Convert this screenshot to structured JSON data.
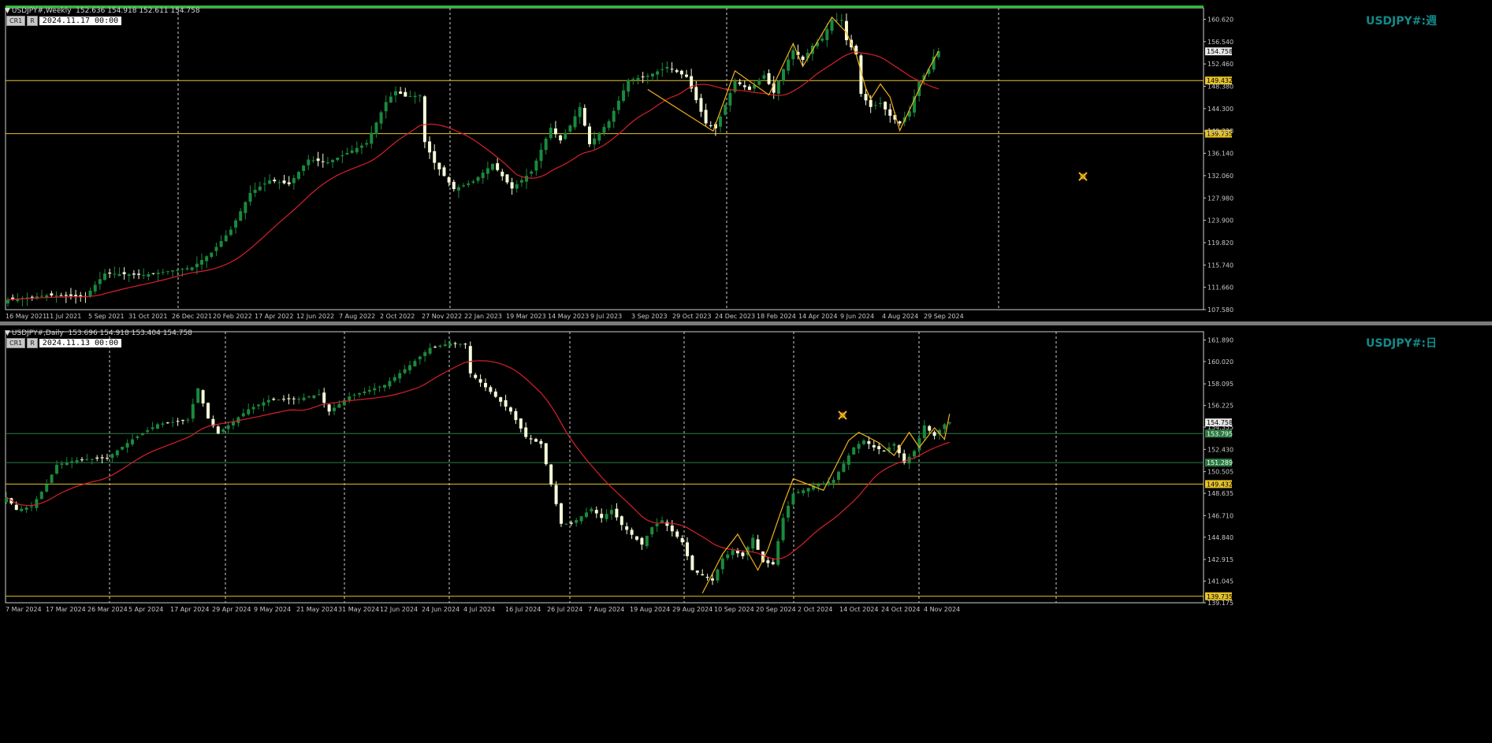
{
  "colors": {
    "bull": "#1a8a3c",
    "bear": "#f4fbd8",
    "ma": "#d8202a",
    "zigzag": "#f2b21c",
    "level": "#e6c22a",
    "level_green": "#2e7a46",
    "axis": "#c8c8c8",
    "frame": "#cfcfcf"
  },
  "chart_data": [
    {
      "type": "candlestick",
      "title": "USDJPY#,Weekly",
      "ohlc_text": "152.636 154.918 152.611 154.758",
      "toolbar": {
        "b1": "CR1",
        "b2": "R",
        "date": "2024.11.17 00:00"
      },
      "symbol_label": "USDJPY#:週",
      "ylim": [
        107.58,
        162.7
      ],
      "yticks": [
        "160.620",
        "156.540",
        "152.460",
        "148.380",
        "144.300",
        "140.220",
        "136.140",
        "132.060",
        "127.980",
        "123.900",
        "119.820",
        "115.740",
        "111.660",
        "107.580"
      ],
      "xticks": [
        "16 May 2021",
        "11 Jul 2021",
        "5 Sep 2021",
        "31 Oct 2021",
        "26 Dec 2021",
        "20 Feb 2022",
        "17 Apr 2022",
        "12 Jun 2022",
        "7 Aug 2022",
        "2 Oct 2022",
        "27 Nov 2022",
        "22 Jan 2023",
        "19 Mar 2023",
        "14 May 2023",
        "9 Jul 2023",
        "3 Sep 2023",
        "29 Oct 2023",
        "24 Dec 2023",
        "18 Feb 2024",
        "14 Apr 2024",
        "9 Jun 2024",
        "4 Aug 2024",
        "29 Sep 2024"
      ],
      "levels": [
        {
          "value": 149.432,
          "label": "149.432",
          "color": "yellow"
        },
        {
          "value": 139.735,
          "label": "139.735",
          "color": "yellow"
        }
      ],
      "current_price": "154.758",
      "close_anchors": [
        [
          0,
          109.4
        ],
        [
          8,
          110.2
        ],
        [
          16,
          110.0
        ],
        [
          20,
          114.2
        ],
        [
          28,
          113.9
        ],
        [
          38,
          115.3
        ],
        [
          42,
          118.0
        ],
        [
          46,
          122.2
        ],
        [
          50,
          128.9
        ],
        [
          54,
          131.2
        ],
        [
          58,
          130.5
        ],
        [
          62,
          135.0
        ],
        [
          66,
          134.5
        ],
        [
          70,
          136.2
        ],
        [
          74,
          138.0
        ],
        [
          78,
          145.5
        ],
        [
          80,
          147.5
        ],
        [
          82,
          146.5
        ],
        [
          85,
          146.7
        ],
        [
          86,
          138.2
        ],
        [
          88,
          134.4
        ],
        [
          92,
          129.6
        ],
        [
          96,
          131.0
        ],
        [
          100,
          134.2
        ],
        [
          104,
          129.7
        ],
        [
          108,
          132.8
        ],
        [
          112,
          140.8
        ],
        [
          114,
          138.5
        ],
        [
          116,
          141.2
        ],
        [
          118,
          144.6
        ],
        [
          120,
          137.8
        ],
        [
          124,
          142.0
        ],
        [
          128,
          149.5
        ],
        [
          132,
          150.3
        ],
        [
          136,
          151.9
        ],
        [
          140,
          150.1
        ],
        [
          144,
          141.6
        ],
        [
          146,
          140.7
        ],
        [
          148,
          145.0
        ],
        [
          150,
          149.3
        ],
        [
          153,
          147.7
        ],
        [
          156,
          150.4
        ],
        [
          158,
          147.2
        ],
        [
          160,
          151.5
        ],
        [
          162,
          155.0
        ],
        [
          164,
          153.2
        ],
        [
          166,
          155.8
        ],
        [
          168,
          157.1
        ],
        [
          170,
          160.5
        ],
        [
          172,
          160.5
        ],
        [
          173,
          156.8
        ],
        [
          175,
          154.2
        ],
        [
          176,
          147.0
        ],
        [
          178,
          144.6
        ],
        [
          180,
          145.3
        ],
        [
          182,
          143.0
        ],
        [
          184,
          141.6
        ],
        [
          186,
          143.8
        ],
        [
          188,
          149.3
        ],
        [
          190,
          151.5
        ],
        [
          191,
          153.8
        ],
        [
          192,
          154.758
        ]
      ],
      "zigzag": [
        [
          132,
          147.8
        ],
        [
          145.5,
          140.2
        ],
        [
          150,
          151.2
        ],
        [
          157,
          146.8
        ],
        [
          162,
          156.2
        ],
        [
          164,
          152.0
        ],
        [
          170,
          161.0
        ],
        [
          173,
          158.2
        ],
        [
          175,
          154.2
        ],
        [
          177,
          148.0
        ],
        [
          178,
          146.0
        ],
        [
          180,
          148.8
        ],
        [
          182,
          146.4
        ],
        [
          184,
          140.3
        ],
        [
          190,
          151.6
        ],
        [
          192,
          154.8
        ]
      ],
      "hidden_count": 192
    },
    {
      "type": "candlestick",
      "title": "USDJPY#,Daily",
      "ohlc_text": "153.696 154.918 153.404 154.758",
      "toolbar": {
        "b1": "CR1",
        "b2": "R",
        "date": "2024.11.13 00:00"
      },
      "symbol_label": "USDJPY#:日",
      "ylim": [
        139.175,
        162.6
      ],
      "yticks": [
        "161.890",
        "160.020",
        "158.095",
        "156.225",
        "154.355",
        "152.430",
        "150.505",
        "148.635",
        "146.710",
        "144.840",
        "142.915",
        "141.045",
        "139.175"
      ],
      "xticks": [
        "7 Mar 2024",
        "17 Mar 2024",
        "26 Mar 2024",
        "5 Apr 2024",
        "17 Apr 2024",
        "29 Apr 2024",
        "9 May 2024",
        "21 May 2024",
        "31 May 2024",
        "12 Jun 2024",
        "24 Jun 2024",
        "4 Jul 2024",
        "16 Jul 2024",
        "26 Jul 2024",
        "7 Aug 2024",
        "19 Aug 2024",
        "29 Aug 2024",
        "10 Sep 2024",
        "20 Sep 2024",
        "2 Oct 2024",
        "14 Oct 2024",
        "24 Oct 2024",
        "4 Nov 2024"
      ],
      "levels": [
        {
          "value": 153.795,
          "label": "153.795",
          "color": "green"
        },
        {
          "value": 151.289,
          "label": "151.289",
          "color": "green"
        },
        {
          "value": 149.432,
          "label": "149.432",
          "color": "yellow"
        },
        {
          "value": 139.735,
          "label": "139.735",
          "color": "yellow"
        }
      ],
      "current_price": "154.758",
      "close_anchors": [
        [
          0,
          148.3
        ],
        [
          2,
          147.2
        ],
        [
          5,
          147.5
        ],
        [
          8,
          149.4
        ],
        [
          10,
          151.1
        ],
        [
          14,
          151.5
        ],
        [
          20,
          151.7
        ],
        [
          25,
          153.3
        ],
        [
          30,
          154.6
        ],
        [
          36,
          155.0
        ],
        [
          38,
          157.7
        ],
        [
          40,
          155.1
        ],
        [
          42,
          153.8
        ],
        [
          48,
          155.9
        ],
        [
          52,
          156.7
        ],
        [
          58,
          156.8
        ],
        [
          62,
          157.2
        ],
        [
          64,
          155.7
        ],
        [
          68,
          157.0
        ],
        [
          75,
          158.0
        ],
        [
          80,
          159.7
        ],
        [
          84,
          161.2
        ],
        [
          88,
          161.6
        ],
        [
          91,
          161.5
        ],
        [
          92,
          159.0
        ],
        [
          96,
          157.4
        ],
        [
          100,
          155.7
        ],
        [
          103,
          153.5
        ],
        [
          106,
          152.9
        ],
        [
          108,
          149.4
        ],
        [
          110,
          146.0
        ],
        [
          112,
          146.0
        ],
        [
          116,
          147.3
        ],
        [
          118,
          146.5
        ],
        [
          120,
          147.2
        ],
        [
          122,
          145.9
        ],
        [
          126,
          144.2
        ],
        [
          128,
          145.7
        ],
        [
          130,
          146.3
        ],
        [
          134,
          144.4
        ],
        [
          136,
          142.0
        ],
        [
          140,
          141.1
        ],
        [
          142,
          143.0
        ],
        [
          144,
          143.7
        ],
        [
          146,
          143.2
        ],
        [
          148,
          144.8
        ],
        [
          150,
          142.7
        ],
        [
          152,
          142.5
        ],
        [
          154,
          146.5
        ],
        [
          156,
          148.6
        ],
        [
          158,
          148.9
        ],
        [
          160,
          149.3
        ],
        [
          162,
          149.5
        ],
        [
          164,
          149.8
        ],
        [
          166,
          151.2
        ],
        [
          168,
          152.6
        ],
        [
          170,
          153.2
        ],
        [
          172,
          152.6
        ],
        [
          174,
          152.3
        ],
        [
          176,
          152.9
        ],
        [
          178,
          151.3
        ],
        [
          180,
          152.3
        ],
        [
          182,
          154.5
        ],
        [
          184,
          153.6
        ],
        [
          186,
          154.6
        ],
        [
          187,
          154.758
        ]
      ],
      "zigzag": [
        [
          138,
          140.0
        ],
        [
          142,
          143.4
        ],
        [
          145,
          145.1
        ],
        [
          149,
          142.0
        ],
        [
          151,
          143.8
        ],
        [
          154,
          147.6
        ],
        [
          156,
          149.9
        ],
        [
          162,
          148.9
        ],
        [
          164,
          150.6
        ],
        [
          167,
          153.2
        ],
        [
          169,
          153.9
        ],
        [
          173,
          153.0
        ],
        [
          176,
          151.9
        ],
        [
          179,
          153.9
        ],
        [
          181,
          152.6
        ],
        [
          184,
          154.3
        ],
        [
          186,
          153.3
        ],
        [
          187,
          155.5
        ]
      ],
      "hidden_count": 187
    }
  ]
}
